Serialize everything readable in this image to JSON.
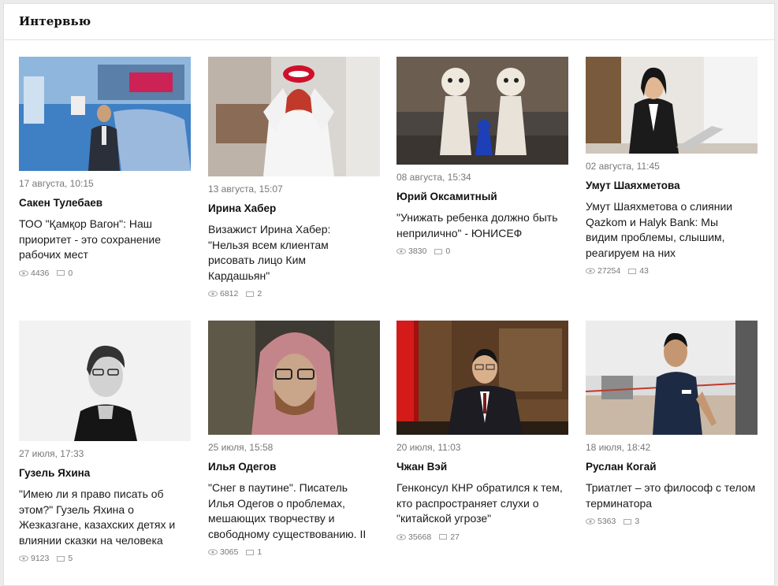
{
  "section": {
    "title": "Интервью"
  },
  "cards": [
    {
      "date": "17 августа, 10:15",
      "name": "Сакен Тулебаев",
      "headline": "ТОО \"Қамқор Вагон\": Наш\nприоритет - это сохранение\nрабочих мест",
      "views": "4436",
      "comments": "0"
    },
    {
      "date": "13 августа, 15:07",
      "name": "Ирина Хабер",
      "headline": "Визажист Ирина Хабер:\n\"Нельзя всем клиентам\nрисовать лицо Ким\nКардашьян\"",
      "views": "6812",
      "comments": "2"
    },
    {
      "date": "08 августа, 15:34",
      "name": "Юрий Оксамитный",
      "headline": "\"Унижать ребенка должно быть\nнеприлично\" - ЮНИСЕФ",
      "views": "3830",
      "comments": "0"
    },
    {
      "date": "02 августа, 11:45",
      "name": "Умут Шаяхметова",
      "headline": "Умут Шаяхметова о слиянии\nQazkom и Halyk Bank: Мы\nвидим проблемы, слышим,\nреагируем на них",
      "views": "27254",
      "comments": "43"
    },
    {
      "date": "27 июля, 17:33",
      "name": "Гузель Яхина",
      "headline": "\"Имею ли я право писать об\nэтом?\" Гузель Яхина о\nЖезказгане, казахских детях и\nвлиянии сказки на человека",
      "views": "9123",
      "comments": "5"
    },
    {
      "date": "25 июля, 15:58",
      "name": "Илья Одегов",
      "headline": "\"Снег в паутине\". Писатель\nИлья Одегов о проблемах,\nмешающих творчеству и\nсвободному существованию. II",
      "views": "3065",
      "comments": "1"
    },
    {
      "date": "20 июля, 11:03",
      "name": "Чжан Вэй",
      "headline": "Генконсул КНР обратился к тем,\nкто распространяет слухи о\n\"китайской угрозе\"",
      "views": "35668",
      "comments": "27"
    },
    {
      "date": "18 июля, 18:42",
      "name": "Руслан Когай",
      "headline": "Триатлет – это философ с телом\nтерминатора",
      "views": "5363",
      "comments": "3"
    }
  ]
}
